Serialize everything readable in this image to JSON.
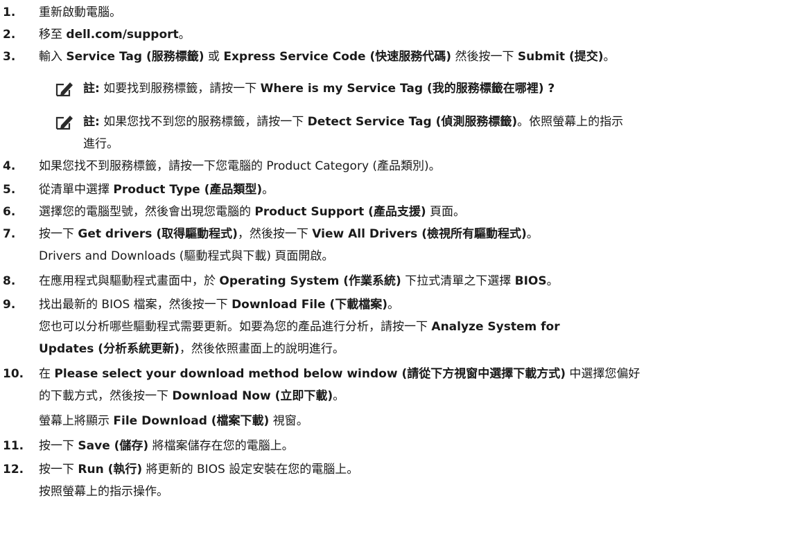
{
  "steps": [
    {
      "num": "1.",
      "parts": [
        {
          "t": "重新啟動電腦。"
        }
      ]
    },
    {
      "num": "2.",
      "parts": [
        {
          "t": "移至 "
        },
        {
          "t": "dell.com/support",
          "b": true
        },
        {
          "t": "。"
        }
      ]
    },
    {
      "num": "3.",
      "parts": [
        {
          "t": "輸入 "
        },
        {
          "t": "Service Tag (服務標籤)",
          "b": true
        },
        {
          "t": " 或 "
        },
        {
          "t": "Express Service Code (快速服務代碼)",
          "b": true
        },
        {
          "t": " 然後按一下 "
        },
        {
          "t": "Submit (提交)",
          "b": true
        },
        {
          "t": "。"
        }
      ]
    },
    {
      "num": "4.",
      "parts": [
        {
          "t": "如果您找不到服務標籤，請按一下您電腦的 Product Category (產品類別)。"
        }
      ]
    },
    {
      "num": "5.",
      "parts": [
        {
          "t": "從清單中選擇 "
        },
        {
          "t": "Product Type (產品類型)",
          "b": true
        },
        {
          "t": "。"
        }
      ]
    },
    {
      "num": "6.",
      "parts": [
        {
          "t": "選擇您的電腦型號，然後會出現您電腦的 "
        },
        {
          "t": "Product Support (產品支援)",
          "b": true
        },
        {
          "t": " 頁面。"
        }
      ]
    },
    {
      "num": "7.",
      "parts": [
        {
          "t": "按一下 "
        },
        {
          "t": "Get drivers (取得驅動程式)",
          "b": true
        },
        {
          "t": "，然後按一下 "
        },
        {
          "t": "View All Drivers (檢視所有驅動程式)",
          "b": true
        },
        {
          "t": "。"
        }
      ]
    },
    {
      "num": "8.",
      "parts": [
        {
          "t": "在應用程式與驅動程式畫面中，於 "
        },
        {
          "t": "Operating System (作業系統)",
          "b": true
        },
        {
          "t": " 下拉式清單之下選擇 "
        },
        {
          "t": "BIOS",
          "b": true
        },
        {
          "t": "。"
        }
      ]
    },
    {
      "num": "9.",
      "parts": [
        {
          "t": "找出最新的 BIOS 檔案，然後按一下 "
        },
        {
          "t": "Download File (下載檔案)",
          "b": true
        },
        {
          "t": "。"
        }
      ]
    },
    {
      "num": "10.",
      "parts": [
        {
          "t": "在 "
        },
        {
          "t": "Please select your download method below window (請從下方視窗中選擇下載方式)",
          "b": true
        },
        {
          "t": " 中選擇您偏好"
        }
      ]
    },
    {
      "num": "11.",
      "parts": [
        {
          "t": "按一下 "
        },
        {
          "t": "Save (儲存)",
          "b": true
        },
        {
          "t": " 將檔案儲存在您的電腦上。"
        }
      ]
    },
    {
      "num": "12.",
      "parts": [
        {
          "t": "按一下 "
        },
        {
          "t": "Run (執行)",
          "b": true
        },
        {
          "t": " 將更新的 BIOS 設定安裝在您的電腦上。"
        }
      ]
    }
  ],
  "notes": [
    {
      "icon": "pencil-note-icon",
      "line1": [
        {
          "t": "註:",
          "b": true
        },
        {
          "t": " 如要找到服務標籤，請按一下 "
        },
        {
          "t": "Where is my Service Tag (我的服務標籤在哪裡) ?",
          "b": true
        }
      ],
      "line2": []
    },
    {
      "icon": "pencil-note-icon",
      "line1": [
        {
          "t": "註:",
          "b": true
        },
        {
          "t": " 如果您找不到您的服務標籤，請按一下 "
        },
        {
          "t": "Detect Service Tag (偵測服務標籤)",
          "b": true
        },
        {
          "t": "。依照螢幕上的指示"
        }
      ],
      "line2": [
        {
          "t": "進行。"
        }
      ]
    }
  ],
  "continuations": [
    {
      "id": "7a",
      "parts": [
        {
          "t": "Drivers and Downloads (驅動程式與下載) 頁面開啟。"
        }
      ]
    },
    {
      "id": "9a",
      "parts": [
        {
          "t": "您也可以分析哪些驅動程式需要更新。如要為您的產品進行分析，請按一下 "
        },
        {
          "t": "Analyze System for",
          "b": true
        }
      ]
    },
    {
      "id": "9b",
      "parts": [
        {
          "t": "Updates (分析系統更新)",
          "b": true
        },
        {
          "t": "，然後依照畫面上的說明進行。"
        }
      ]
    },
    {
      "id": "10a",
      "parts": [
        {
          "t": "的下載方式，然後按一下 "
        },
        {
          "t": "Download Now (立即下載)",
          "b": true
        },
        {
          "t": "。"
        }
      ]
    },
    {
      "id": "10b",
      "parts": [
        {
          "t": "螢幕上將顯示 "
        },
        {
          "t": "File Download (檔案下載)",
          "b": true
        },
        {
          "t": " 視窗。"
        }
      ]
    },
    {
      "id": "12a",
      "parts": [
        {
          "t": "按照螢幕上的指示操作。"
        }
      ]
    }
  ],
  "colors": {
    "text": "#1a1a1a",
    "icon": "#2b2b2b"
  }
}
